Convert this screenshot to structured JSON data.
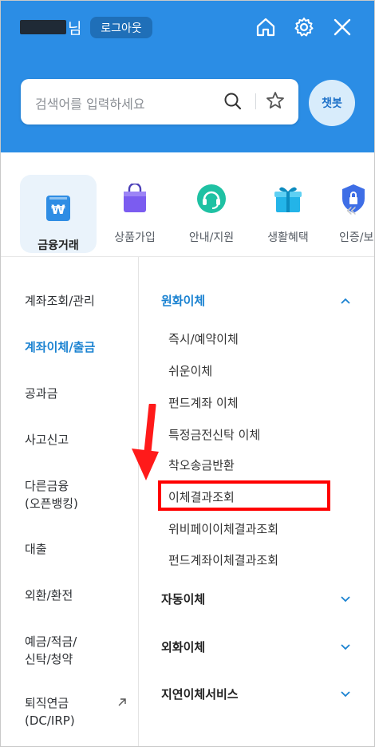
{
  "header": {
    "user_suffix": "님",
    "logout_label": "로그아웃",
    "search_placeholder": "검색어를 입력하세요",
    "chatbot_label": "챗봇",
    "accent_color": "#2b8de5"
  },
  "categories": [
    {
      "label": "금융거래",
      "icon": "wallet-won-icon",
      "active": true
    },
    {
      "label": "상품가입",
      "icon": "shopping-bag-icon"
    },
    {
      "label": "안내/지원",
      "icon": "headset-icon"
    },
    {
      "label": "생활혜택",
      "icon": "gift-icon"
    },
    {
      "label": "인증/보",
      "icon": "shield-lock-icon"
    }
  ],
  "left_menu": [
    {
      "label": "계좌조회/관리"
    },
    {
      "label": "계좌이체/출금",
      "active": true
    },
    {
      "label": "공과금"
    },
    {
      "label": "사고신고"
    },
    {
      "label": "다른금융\n(오픈뱅킹)"
    },
    {
      "label": "대출"
    },
    {
      "label": "외환/환전"
    },
    {
      "label": "예금/적금/\n신탁/청약"
    },
    {
      "label": "퇴직연금\n(DC/IRP)"
    }
  ],
  "right_menu": {
    "sections": [
      {
        "title": "원화이체",
        "expanded": true,
        "items": [
          "즉시/예약이체",
          "쉬운이체",
          "펀드계좌 이체",
          "특정금전신탁 이체",
          "착오송금반환",
          "이체결과조회",
          "위비페이이체결과조회",
          "펀드계좌이체결과조회"
        ]
      },
      {
        "title": "자동이체",
        "expanded": false
      },
      {
        "title": "외화이체",
        "expanded": false
      },
      {
        "title": "지연이체서비스",
        "expanded": false
      }
    ],
    "highlighted_item": "이체결과조회"
  }
}
